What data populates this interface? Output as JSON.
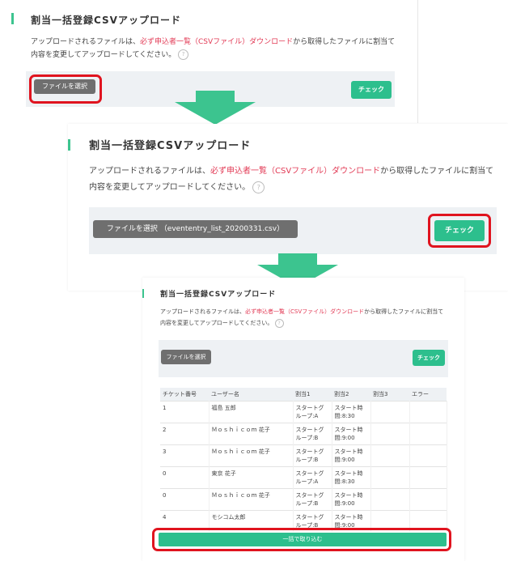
{
  "section_title": "割当一括登録CSVアップロード",
  "description": {
    "before": "アップロードされるファイルは、",
    "link": "必ず申込者一覧（CSVファイル）ダウンロード",
    "after": "から取得したファイルに割当て",
    "line2": "内容を変更してアップロードしてください。",
    "help_icon": "?"
  },
  "step1": {
    "file_button": "ファイルを選択",
    "check_button": "チェック"
  },
  "step2": {
    "file_button": "ファイルを選択 （evententry_list_20200331.csv）",
    "check_button": "チェック"
  },
  "step3": {
    "file_button": "ファイルを選択",
    "check_button": "チェック",
    "table": {
      "headers": [
        "チケット番号",
        "ユーザー名",
        "割当1",
        "割当2",
        "割当3",
        "エラー"
      ],
      "rows": [
        [
          "1",
          "福島 五郎",
          "スタートグループ:A",
          "スタート時間:8:30",
          "",
          ""
        ],
        [
          "2",
          "Ｍｏｓｈｉｃｏｍ 花子",
          "スタートグループ:B",
          "スタート時間:9:00",
          "",
          ""
        ],
        [
          "3",
          "Ｍｏｓｈｉｃｏｍ 花子",
          "スタートグループ:B",
          "スタート時間:9:00",
          "",
          ""
        ],
        [
          "0",
          "東京 花子",
          "スタートグループ:A",
          "スタート時間:8:30",
          "",
          ""
        ],
        [
          "0",
          "Ｍｏｓｈｉｃｏｍ 花子",
          "スタートグループ:B",
          "スタート時間:9:00",
          "",
          ""
        ],
        [
          "4",
          "モシコム太郎",
          "スタートグループ:B",
          "スタート時間:9:00",
          "",
          ""
        ]
      ]
    },
    "bulk_button": "一括で取り込む"
  },
  "colors": {
    "accent": "#2dbf8d",
    "highlight": "#e0141f",
    "link": "#e23a55"
  }
}
